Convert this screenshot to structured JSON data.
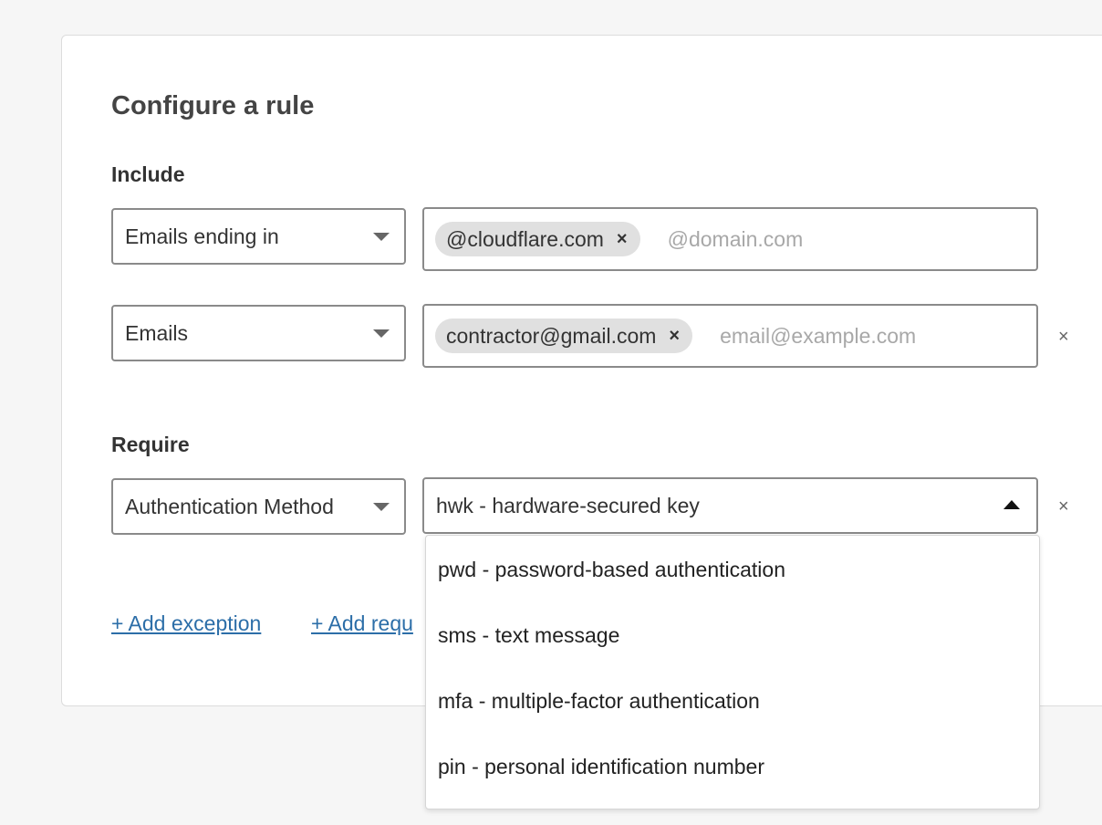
{
  "page": {
    "title": "Configure a rule"
  },
  "include": {
    "label": "Include",
    "rows": [
      {
        "selector": "Emails ending in",
        "chips": [
          "@cloudflare.com"
        ],
        "placeholder": "@domain.com",
        "removable": false
      },
      {
        "selector": "Emails",
        "chips": [
          "contractor@gmail.com"
        ],
        "placeholder": "email@example.com",
        "removable": true
      }
    ]
  },
  "require": {
    "label": "Require",
    "selector": "Authentication Method",
    "value": "hwk - hardware-secured key",
    "options": [
      "pwd - password-based authentication",
      "sms - text message",
      "mfa - multiple-factor authentication",
      "pin - personal identification number"
    ]
  },
  "actions": {
    "add_exception": "+ Add exception",
    "add_require": "+ Add requ"
  },
  "icons": {
    "remove": "×"
  },
  "colors": {
    "link": "#2c6ea8",
    "chip_bg": "#e0e0e0",
    "border": "#8a8a8a",
    "background": "#f6f6f6"
  }
}
